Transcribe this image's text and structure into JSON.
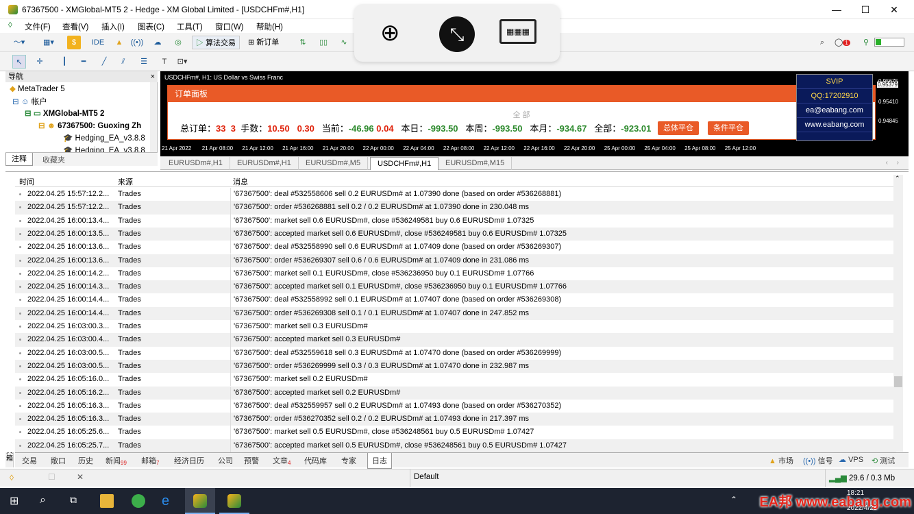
{
  "window": {
    "title": "67367500 - XMGlobal-MT5 2 - Hedge - XM Global Limited - [USDCHFm#,H1]",
    "minimize": "—",
    "maximize": "☐",
    "close": "✕"
  },
  "menu": [
    "文件(F)",
    "查看(V)",
    "插入(I)",
    "图表(C)",
    "工具(T)",
    "窗口(W)",
    "帮助(H)"
  ],
  "toolbar": {
    "ide": "IDE",
    "algo": "算法交易",
    "new_order": "新订单"
  },
  "navigator": {
    "title": "导航",
    "close": "×",
    "items": [
      "MetaTrader 5",
      "帐户",
      "XMGlobal-MT5 2",
      "67367500: Guoxing Zh",
      "Hedging_EA_v3.8.8",
      "Hedging_EA_v3.8.8"
    ],
    "tabs": [
      "注释",
      "收藏夹"
    ]
  },
  "chart": {
    "title": "USDCHFm#, H1:  US Dollar vs Swiss Franc",
    "prices": [
      "0.95675",
      "0.95379",
      "0.95410",
      "0.94845"
    ],
    "time_labels": [
      "21 Apr 2022",
      "21 Apr 08:00",
      "21 Apr 12:00",
      "21 Apr 16:00",
      "21 Apr 20:00",
      "22 Apr 00:00",
      "22 Apr 04:00",
      "22 Apr 08:00",
      "22 Apr 12:00",
      "22 Apr 16:00",
      "22 Apr 20:00",
      "25 Apr 00:00",
      "25 Apr 04:00",
      "25 Apr 08:00",
      "25 Apr 12:00"
    ],
    "panel": {
      "head": "订单面板",
      "sub": "全 部",
      "total_orders_label": "总订单：",
      "total_orders": "33",
      "total_orders2": "3",
      "lots_label": "手数：",
      "lots": "10.50",
      "lots2": "0.30",
      "current_label": "当前：",
      "current": "-46.96",
      "current2": "0.04",
      "today_label": "本日：",
      "today": "-993.50",
      "week_label": "本周：",
      "week": "-993.50",
      "month_label": "本月：",
      "month": "-934.67",
      "all_label": "全部：",
      "all": "-923.01",
      "btn_close_all": "总体平仓",
      "btn_cond": "条件平仓"
    },
    "vip": [
      "SVIP",
      "QQ:17202910",
      "ea@eabang.com",
      "www.eabang.com"
    ]
  },
  "chart_tabs": [
    "EURUSDm#,H1",
    "EURUSDm#,H1",
    "EURUSDm#,M5",
    "USDCHFm#,H1",
    "EURUSDm#,M15"
  ],
  "journal": {
    "headers": {
      "time": "时间",
      "source": "来源",
      "message": "消息"
    },
    "rows": [
      {
        "time": "2022.04.25 15:57:12.2...",
        "source": "Trades",
        "msg": "'67367500': deal #532558606 sell 0.2 EURUSDm# at 1.07390 done (based on order #536268881)"
      },
      {
        "time": "2022.04.25 15:57:12.2...",
        "source": "Trades",
        "msg": "'67367500': order #536268881 sell 0.2 / 0.2 EURUSDm# at 1.07390 done in 230.048 ms"
      },
      {
        "time": "2022.04.25 16:00:13.4...",
        "source": "Trades",
        "msg": "'67367500': market sell 0.6 EURUSDm#, close #536249581 buy 0.6 EURUSDm# 1.07325"
      },
      {
        "time": "2022.04.25 16:00:13.5...",
        "source": "Trades",
        "msg": "'67367500': accepted market sell 0.6 EURUSDm#, close #536249581 buy 0.6 EURUSDm# 1.07325"
      },
      {
        "time": "2022.04.25 16:00:13.6...",
        "source": "Trades",
        "msg": "'67367500': deal #532558990 sell 0.6 EURUSDm# at 1.07409 done (based on order #536269307)"
      },
      {
        "time": "2022.04.25 16:00:13.6...",
        "source": "Trades",
        "msg": "'67367500': order #536269307 sell 0.6 / 0.6 EURUSDm# at 1.07409 done in 231.086 ms"
      },
      {
        "time": "2022.04.25 16:00:14.2...",
        "source": "Trades",
        "msg": "'67367500': market sell 0.1 EURUSDm#, close #536236950 buy 0.1 EURUSDm# 1.07766"
      },
      {
        "time": "2022.04.25 16:00:14.3...",
        "source": "Trades",
        "msg": "'67367500': accepted market sell 0.1 EURUSDm#, close #536236950 buy 0.1 EURUSDm# 1.07766"
      },
      {
        "time": "2022.04.25 16:00:14.4...",
        "source": "Trades",
        "msg": "'67367500': deal #532558992 sell 0.1 EURUSDm# at 1.07407 done (based on order #536269308)"
      },
      {
        "time": "2022.04.25 16:00:14.4...",
        "source": "Trades",
        "msg": "'67367500': order #536269308 sell 0.1 / 0.1 EURUSDm# at 1.07407 done in 247.852 ms"
      },
      {
        "time": "2022.04.25 16:03:00.3...",
        "source": "Trades",
        "msg": "'67367500': market sell 0.3 EURUSDm#"
      },
      {
        "time": "2022.04.25 16:03:00.4...",
        "source": "Trades",
        "msg": "'67367500': accepted market sell 0.3 EURUSDm#"
      },
      {
        "time": "2022.04.25 16:03:00.5...",
        "source": "Trades",
        "msg": "'67367500': deal #532559618 sell 0.3 EURUSDm# at 1.07470 done (based on order #536269999)"
      },
      {
        "time": "2022.04.25 16:03:00.5...",
        "source": "Trades",
        "msg": "'67367500': order #536269999 sell 0.3 / 0.3 EURUSDm# at 1.07470 done in 232.987 ms"
      },
      {
        "time": "2022.04.25 16:05:16.0...",
        "source": "Trades",
        "msg": "'67367500': market sell 0.2 EURUSDm#"
      },
      {
        "time": "2022.04.25 16:05:16.2...",
        "source": "Trades",
        "msg": "'67367500': accepted market sell 0.2 EURUSDm#"
      },
      {
        "time": "2022.04.25 16:05:16.3...",
        "source": "Trades",
        "msg": "'67367500': deal #532559957 sell 0.2 EURUSDm# at 1.07493 done (based on order #536270352)"
      },
      {
        "time": "2022.04.25 16:05:16.3...",
        "source": "Trades",
        "msg": "'67367500': order #536270352 sell 0.2 / 0.2 EURUSDm# at 1.07493 done in 217.397 ms"
      },
      {
        "time": "2022.04.25 16:05:25.6...",
        "source": "Trades",
        "msg": "'67367500': market sell 0.5 EURUSDm#, close #536248561 buy 0.5 EURUSDm# 1.07427"
      },
      {
        "time": "2022.04.25 16:05:25.7...",
        "source": "Trades",
        "msg": "'67367500': accepted market sell 0.5 EURUSDm#, close #536248561 buy 0.5 EURUSDm# 1.07427"
      }
    ]
  },
  "terminal_tabs": [
    {
      "label": "交易",
      "badge": ""
    },
    {
      "label": "敞口",
      "badge": ""
    },
    {
      "label": "历史",
      "badge": ""
    },
    {
      "label": "新闻",
      "badge": "99"
    },
    {
      "label": "邮箱",
      "badge": "7"
    },
    {
      "label": "经济日历",
      "badge": ""
    },
    {
      "label": "公司",
      "badge": ""
    },
    {
      "label": "预警",
      "badge": ""
    },
    {
      "label": "文章",
      "badge": "4"
    },
    {
      "label": "代码库",
      "badge": ""
    },
    {
      "label": "专家",
      "badge": ""
    },
    {
      "label": "日志",
      "badge": ""
    }
  ],
  "terminal_side_label": "工具箱",
  "terminal_right": [
    "市场",
    "信号",
    "VPS",
    "测试"
  ],
  "status": {
    "profile": "Default",
    "traffic": "29.6 / 0.3 Mb"
  },
  "taskbar": {
    "clock": "18:21",
    "date": "2022/4/25",
    "brand": "EA邦 www.eabang.com"
  }
}
